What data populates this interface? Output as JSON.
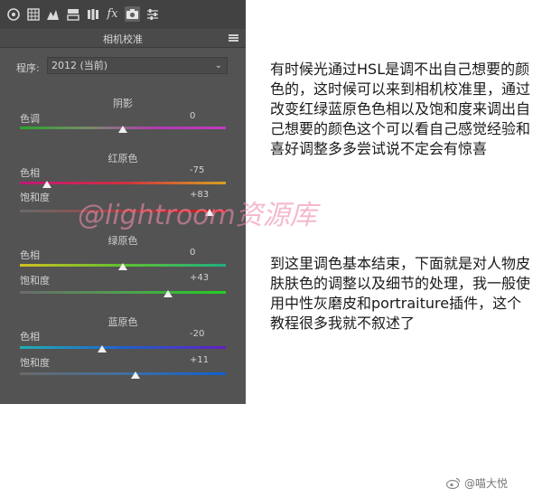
{
  "toolbar": {
    "icons": [
      "aperture-icon",
      "grid-icon",
      "tone-curve-icon",
      "split-panels-icon",
      "lens-icon",
      "fx-icon",
      "camera-icon",
      "sliders-icon"
    ],
    "fx_label": "fx"
  },
  "panel": {
    "title": "相机校准",
    "process_label": "程序:",
    "process_value": "2012 (当前)",
    "sections": [
      {
        "title": "阴影",
        "sliders": [
          {
            "label": "色调",
            "value": "0",
            "level": 0.5
          }
        ]
      },
      {
        "title": "红原色",
        "sliders": [
          {
            "label": "色相",
            "value": "-75",
            "level": 0.13
          },
          {
            "label": "饱和度",
            "value": "+83",
            "level": 0.92
          }
        ]
      },
      {
        "title": "绿原色",
        "sliders": [
          {
            "label": "色相",
            "value": "0",
            "level": 0.5
          },
          {
            "label": "饱和度",
            "value": "+43",
            "level": 0.72
          }
        ]
      },
      {
        "title": "蓝原色",
        "sliders": [
          {
            "label": "色相",
            "value": "-20",
            "level": 0.4
          },
          {
            "label": "饱和度",
            "value": "+11",
            "level": 0.56
          }
        ]
      }
    ]
  },
  "text": {
    "paragraph1": "有时候光通过HSL是调不出自己想要的颜色的，这时候可以来到相机校准里，通过改变红绿蓝原色色相以及饱和度来调出自己想要的颜色这个可以看自己感觉经验和喜好调整多多尝试说不定会有惊喜",
    "paragraph2": "到这里调色基本结束，下面就是对人物皮肤肤色的调整以及细节的处理，我一般使用中性灰磨皮和portraiture插件，这个教程很多我就不叙述了"
  },
  "watermark": "@lightroom资源库",
  "weibo": "@喵大悦",
  "colors": {
    "panel_bg": "#535353",
    "toolbar_bg": "#424242",
    "panel_text": "#d2d2d2"
  }
}
